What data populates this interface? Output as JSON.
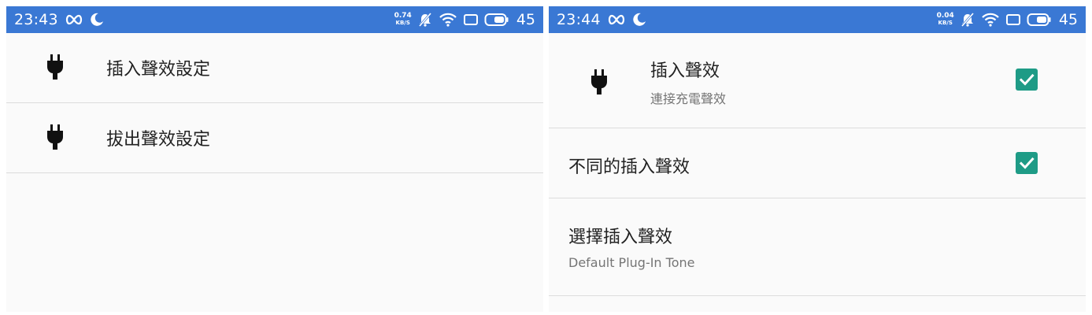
{
  "left": {
    "statusbar": {
      "time": "23:43",
      "speed_value": "0.74",
      "speed_unit": "KB/S",
      "battery": "45",
      "icons": [
        "infinity-icon",
        "moon-icon",
        "silent-bell-icon",
        "wifi-icon",
        "screen-icon",
        "battery-icon"
      ]
    },
    "items": [
      {
        "icon": "plug-icon",
        "title": "插入聲效設定"
      },
      {
        "icon": "plug-icon",
        "title": "拔出聲效設定"
      }
    ]
  },
  "right": {
    "statusbar": {
      "time": "23:44",
      "speed_value": "0.04",
      "speed_unit": "KB/S",
      "battery": "45",
      "icons": [
        "infinity-icon",
        "moon-icon",
        "silent-bell-icon",
        "wifi-icon",
        "screen-icon",
        "battery-icon"
      ]
    },
    "items": [
      {
        "icon": "plug-icon",
        "title": "插入聲效",
        "summary": "連接充電聲效",
        "checked": true
      },
      {
        "title": "不同的插入聲效",
        "checked": true
      },
      {
        "title": "選擇插入聲效",
        "summary": "Default Plug-In Tone"
      }
    ]
  },
  "colors": {
    "statusbar": "#3a78d4",
    "checkbox": "#1e9b86",
    "background": "#fafafa",
    "divider": "#dcdcdc"
  }
}
